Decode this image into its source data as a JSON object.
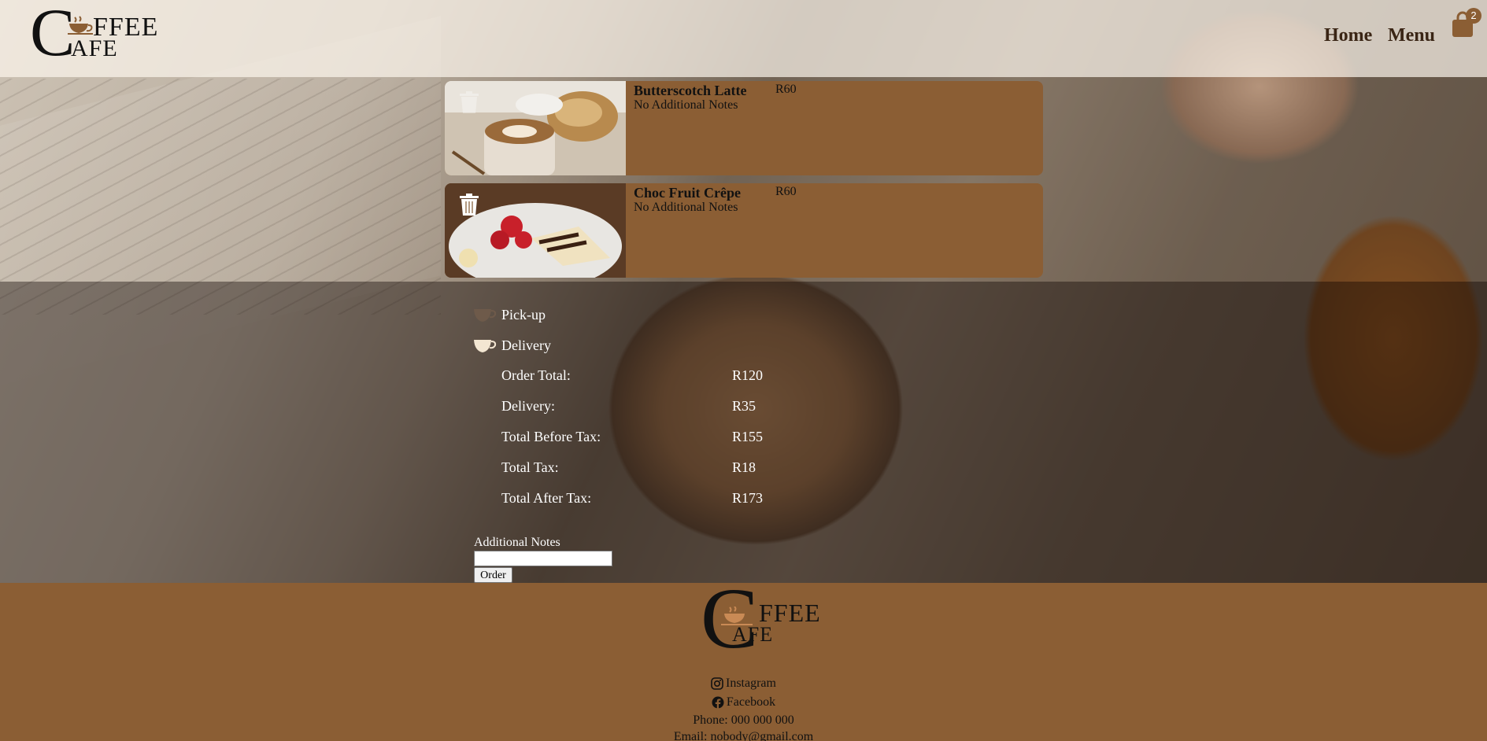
{
  "header": {
    "logo_word1": "FFEE",
    "logo_word2": "AFE",
    "logo_letter": "C",
    "nav": {
      "home": "Home",
      "menu": "Menu"
    },
    "cart": {
      "icon": "shopping-bag-icon",
      "count": "2"
    }
  },
  "cart_items": [
    {
      "name": "Butterscotch Latte",
      "price": "R60",
      "notes": "No Additional Notes",
      "image": "latte-photo"
    },
    {
      "name": "Choc Fruit Crêpe",
      "price": "R60",
      "notes": "No Additional Notes",
      "image": "crepe-photo",
      "delete_icon": "trash-icon"
    }
  ],
  "fulfilment": {
    "pickup_label": "Pick-up",
    "delivery_label": "Delivery",
    "selected": "Delivery"
  },
  "summary": {
    "order_total_label": "Order Total:",
    "order_total": "R120",
    "delivery_label": "Delivery:",
    "delivery": "R35",
    "before_tax_label": "Total Before Tax:",
    "before_tax": "R155",
    "tax_label": "Total Tax:",
    "tax": "R18",
    "after_tax_label": "Total After Tax:",
    "after_tax": "R173"
  },
  "notes": {
    "label": "Additional Notes",
    "value": "",
    "button": "Order"
  },
  "footer": {
    "instagram": "Instagram",
    "facebook": "Facebook",
    "phone": "Phone: 000 000 000",
    "email": "Email: nobody@gmail.com"
  },
  "colors": {
    "brand_brown": "#8b5e34",
    "header_bg": "#f0e8de",
    "text_dark": "#111111"
  }
}
